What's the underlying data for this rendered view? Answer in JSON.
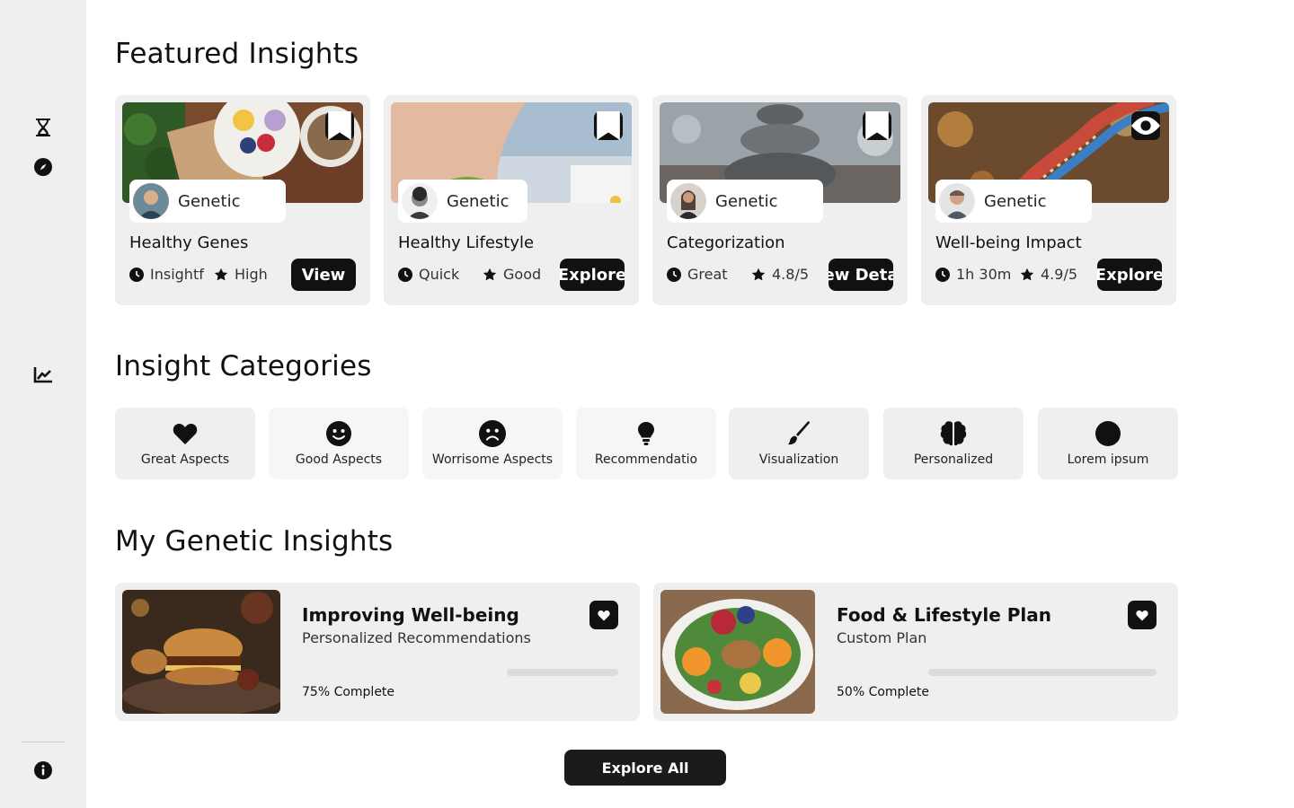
{
  "sidebar": {
    "icons": [
      "hourglass-icon",
      "compass-icon",
      "chart-line-icon",
      "info-icon"
    ]
  },
  "sections": {
    "featured": "Featured Insights",
    "categories": "Insight Categories",
    "mine": "My Genetic Insights"
  },
  "featured": [
    {
      "tag": "Genetic",
      "title": "Healthy Genes",
      "meta1": "Insightf",
      "meta2": "High",
      "button": "View",
      "action_icon": "bookmark-icon"
    },
    {
      "tag": "Genetic",
      "title": "Healthy Lifestyle",
      "meta1": "Quick",
      "meta2": "Good",
      "button": "Explore",
      "action_icon": "bookmark-icon"
    },
    {
      "tag": "Genetic",
      "title": "Categorization",
      "meta1": "Great",
      "meta2": "4.8/5",
      "button": "ew Deta",
      "action_icon": "bookmark-icon"
    },
    {
      "tag": "Genetic",
      "title": "Well-being Impact",
      "meta1": "1h 30m",
      "meta2": "4.9/5",
      "button": "Explore",
      "action_icon": "eye-icon"
    }
  ],
  "categories": [
    {
      "label": "Great Aspects",
      "icon": "heart-icon"
    },
    {
      "label": "Good Aspects",
      "icon": "smile-icon"
    },
    {
      "label": "Worrisome Aspects",
      "icon": "frown-icon"
    },
    {
      "label": "Recommendatio",
      "icon": "lightbulb-icon"
    },
    {
      "label": "Visualization",
      "icon": "brush-icon"
    },
    {
      "label": "Personalized",
      "icon": "brain-icon"
    },
    {
      "label": "Lorem ipsum",
      "icon": "circle-icon"
    }
  ],
  "insights": [
    {
      "title": "Improving Well-being",
      "subtitle": "Personalized Recommendations",
      "progress_label": "75% Complete",
      "progress": 0.75
    },
    {
      "title": "Food & Lifestyle Plan",
      "subtitle": "Custom Plan",
      "progress_label": "50% Complete",
      "progress": 0.5
    }
  ],
  "explore_all": "Explore All",
  "colors": {
    "dark": "#111111",
    "card_bg": "#efefef",
    "sidebar_bg": "#efefef"
  }
}
